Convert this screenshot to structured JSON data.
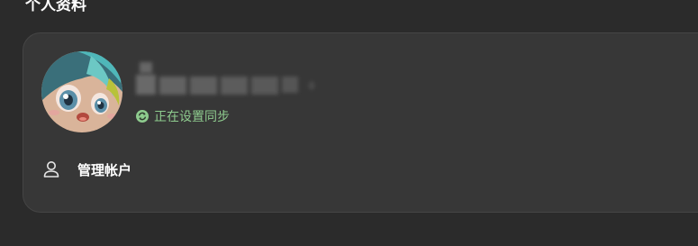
{
  "section": {
    "title": "个人资料"
  },
  "profile": {
    "avatar_icon": "avatar-image",
    "sync_status": "正在设置同步",
    "sync_icon": "sync-icon",
    "sync_color": "#8ecb8e"
  },
  "actions": {
    "manage_account_label": "管理帐户",
    "manage_account_icon": "user-icon"
  }
}
